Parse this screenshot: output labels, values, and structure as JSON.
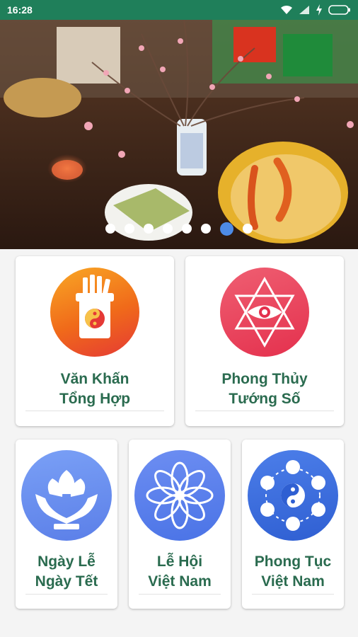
{
  "status_bar": {
    "time": "16:28",
    "icons": [
      "wifi-icon",
      "signal-icon",
      "charging-icon",
      "battery-icon"
    ]
  },
  "banner": {
    "slides": 8,
    "active_slide_index": 6,
    "image": "altar-offerings-photo"
  },
  "menu": {
    "van_khan": {
      "line1": "Văn Khấn",
      "line2": "Tổng Hợp",
      "icon": "incense-yin-yang-icon"
    },
    "phong_thuy": {
      "line1": "Phong Thủy",
      "line2": "Tướng Số",
      "icon": "star-of-david-eye-icon"
    },
    "ngay_le": {
      "line1": "Ngày Lễ",
      "line2": "Ngày Tết",
      "icon": "lotus-hands-icon"
    },
    "le_hoi": {
      "line1": "Lễ Hội",
      "line2": "Việt Nam",
      "icon": "mandala-flower-icon"
    },
    "phong_tuc": {
      "line1": "Phong Tục",
      "line2": "Việt Nam",
      "icon": "yin-yang-circles-icon"
    }
  },
  "colors": {
    "status_bar": "#1f7f5a",
    "title_text": "#2a6b4f",
    "active_dot": "#4d8be6"
  }
}
